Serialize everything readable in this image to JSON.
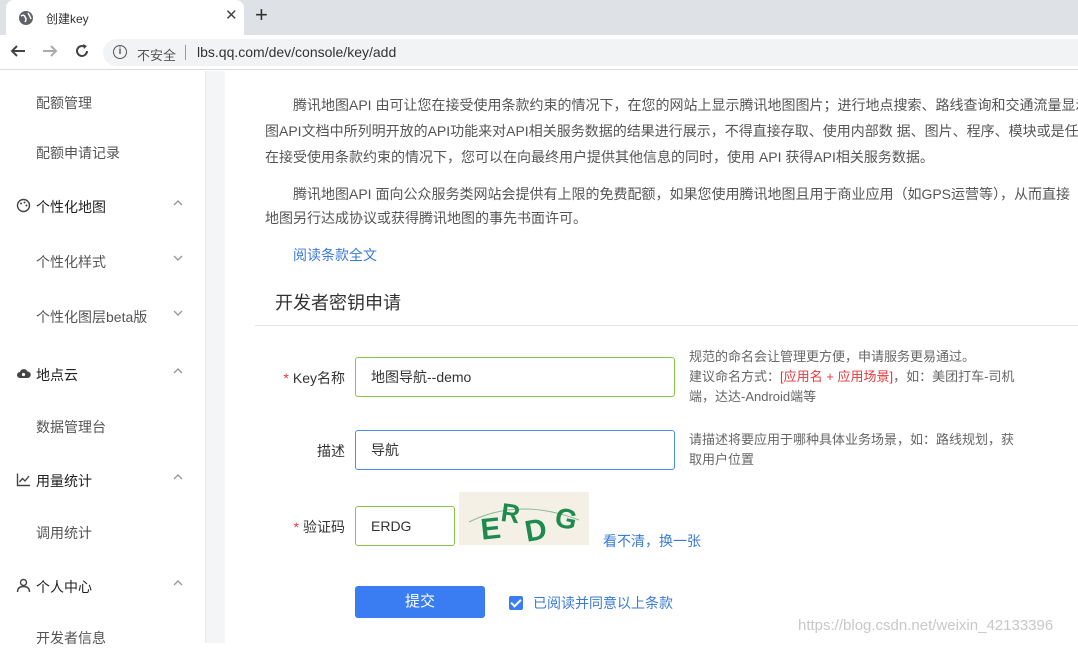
{
  "browser": {
    "tab_title": "创建key",
    "close_glyph": "✕",
    "newtab_glyph": "+",
    "security_label": "不安全",
    "url": "lbs.qq.com/dev/console/key/add"
  },
  "sidebar": {
    "items": [
      {
        "label": "配额管理",
        "kind": "sub"
      },
      {
        "label": "配额申请记录",
        "kind": "sub"
      },
      {
        "label": "个性化地图",
        "kind": "group",
        "icon": "palette-icon"
      },
      {
        "label": "个性化样式",
        "kind": "sub"
      },
      {
        "label": "个性化图层beta版",
        "kind": "sub"
      },
      {
        "label": "地点云",
        "kind": "group",
        "icon": "cloud-icon"
      },
      {
        "label": "数据管理台",
        "kind": "sub"
      },
      {
        "label": "用量统计",
        "kind": "group",
        "icon": "line-chart-icon"
      },
      {
        "label": "调用统计",
        "kind": "sub"
      },
      {
        "label": "个人中心",
        "kind": "group",
        "icon": "user-icon"
      },
      {
        "label": "开发者信息",
        "kind": "sub"
      }
    ]
  },
  "terms": {
    "p1_l1": "腾讯地图API 由可让您在接受使用条款约束的情况下，在您的网站上显示腾讯地图图片；进行地点搜索、路线查询和交通流量显示",
    "p1_l2": "图API文档中所列明开放的API功能来对API相关服务数据的结果进行展示，不得直接存取、使用内部数 据、图片、程序、模块或是任",
    "p1_l3": "在接受使用条款约束的情况下，您可以在向最终用户提供其他信息的同时，使用 API 获得API相关服务数据。",
    "p2_l1": "腾讯地图API 面向公众服务类网站会提供有上限的免费配额，如果您使用腾讯地图且用于商业应用（如GPS运营等），从而直接",
    "p2_l2": "地图另行达成协议或获得腾讯地图的事先书面许可。",
    "read_full": "阅读条款全文"
  },
  "form": {
    "section_title": "开发者密钥申请",
    "required_mark": "*",
    "key_name_label": "Key名称",
    "key_name_value": "地图导航--demo",
    "key_name_hint_1": "规范的命名会让管理更方便，申请服务更易通过。",
    "key_name_hint_2a": "建议命名方式：",
    "key_name_hint_2b": "[应用名 + 应用场景]",
    "key_name_hint_2c": "，如：美团打车-司机",
    "key_name_hint_3": "端，达达-Android端等",
    "desc_label": "描述",
    "desc_value": "导航",
    "desc_hint_1": "请描述将要应用于哪种具体业务场景，如：路线规划，获",
    "desc_hint_2": "取用户位置",
    "captcha_label": "验证码",
    "captcha_value": "ERDG",
    "captcha_text": "ERDG",
    "refresh_captcha": "看不清，换一张",
    "submit": "提交",
    "agree": "已阅读并同意以上条款"
  },
  "watermark": "https://blog.csdn.net/weixin_42133396"
}
